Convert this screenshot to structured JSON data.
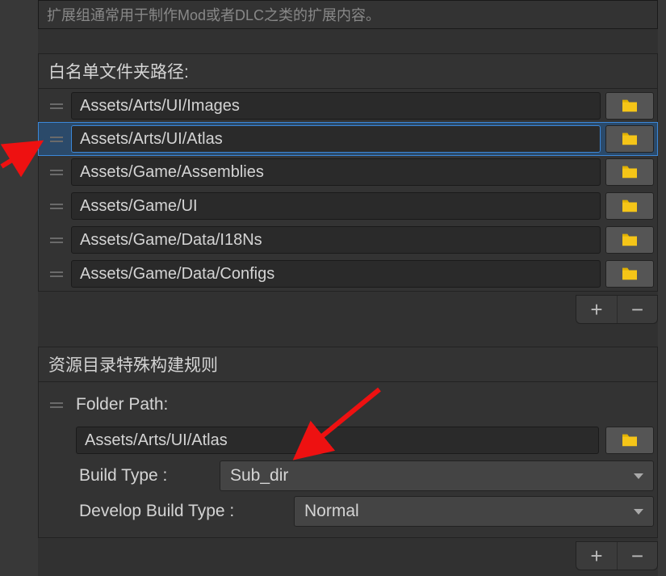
{
  "info_text": "扩展组通常用于制作Mod或者DLC之类的扩展内容。",
  "whitelist": {
    "header": "白名单文件夹路径:",
    "paths": [
      "Assets/Arts/UI/Images",
      "Assets/Arts/UI/Atlas",
      "Assets/Game/Assemblies",
      "Assets/Game/UI",
      "Assets/Game/Data/I18Ns",
      "Assets/Game/Data/Configs"
    ],
    "selected_index": 1
  },
  "special_rules": {
    "header": "资源目录特殊构建规则",
    "folder_path_label": "Folder Path:",
    "folder_path_value": "Assets/Arts/UI/Atlas",
    "build_type_label": "Build Type :",
    "build_type_value": "Sub_dir",
    "dev_build_type_label": "Develop Build Type :",
    "dev_build_type_value": "Normal"
  },
  "icons": {
    "add": "+",
    "remove": "−"
  }
}
